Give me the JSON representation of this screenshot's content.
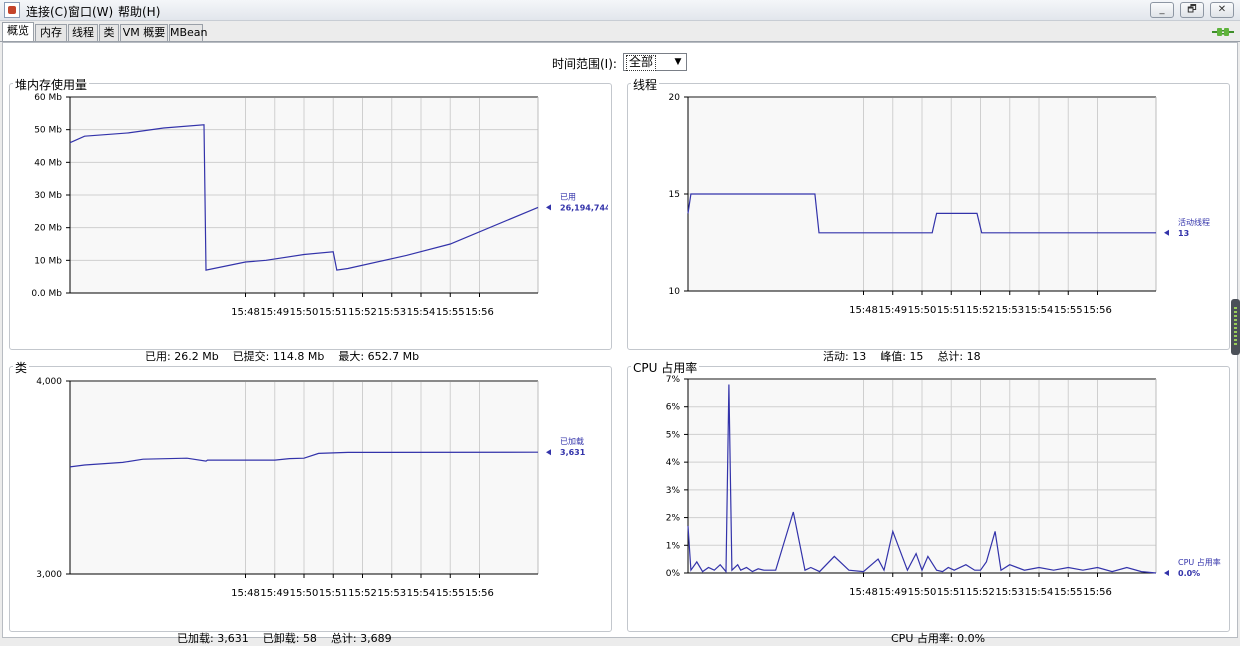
{
  "menubar": {
    "items": [
      "连接(C)",
      "窗口(W)",
      "帮助(H)"
    ],
    "window_buttons": [
      "_",
      "🗗",
      "✕"
    ]
  },
  "tabs": [
    "概览",
    "内存",
    "线程",
    "类",
    "VM 概要",
    "MBean"
  ],
  "time_range": {
    "label": "时间范围(I):",
    "value": "全部"
  },
  "x_ticks": [
    "15:48",
    "15:49",
    "15:50",
    "15:51",
    "15:52",
    "15:53",
    "15:54",
    "15:55",
    "15:56"
  ],
  "panels": {
    "heap": {
      "title": "堆内存使用量",
      "stats": [
        {
          "label": "已用:",
          "value": "26.2 Mb"
        },
        {
          "label": "已提交:",
          "value": "114.8 Mb"
        },
        {
          "label": "最大:",
          "value": "652.7 Mb"
        }
      ]
    },
    "threads": {
      "title": "线程",
      "stats": [
        {
          "label": "活动:",
          "value": "13"
        },
        {
          "label": "峰值:",
          "value": "15"
        },
        {
          "label": "总计:",
          "value": "18"
        }
      ]
    },
    "classes": {
      "title": "类",
      "stats": [
        {
          "label": "已加载:",
          "value": "3,631"
        },
        {
          "label": "已卸载:",
          "value": "58"
        },
        {
          "label": "总计:",
          "value": "3,689"
        }
      ]
    },
    "cpu": {
      "title": "CPU 占用率",
      "stats": [
        {
          "label": "CPU 占用率:",
          "value": "0.0%"
        }
      ]
    }
  },
  "chart_data": [
    {
      "type": "line",
      "title": "堆内存使用量",
      "y_tick_labels": [
        "0.0 Mb",
        "10 Mb",
        "20 Mb",
        "30 Mb",
        "40 Mb",
        "50 Mb",
        "60 Mb"
      ],
      "ylim": [
        0,
        60
      ],
      "xlim": [
        15.42,
        15.58
      ],
      "x_tick_values": [
        15.48,
        15.49,
        15.5,
        15.51,
        15.52,
        15.53,
        15.54,
        15.55,
        15.56
      ],
      "series": [
        {
          "name": "已用",
          "value_label": "26,194,744",
          "x": [
            15.42,
            15.425,
            15.44,
            15.452,
            15.4658,
            15.4665,
            15.48,
            15.487,
            15.5,
            15.51,
            15.5112,
            15.515,
            15.535,
            15.55,
            15.58
          ],
          "y": [
            46,
            48,
            49,
            50.5,
            51.5,
            7,
            9.5,
            10,
            11.8,
            12.6,
            7,
            7.5,
            11.5,
            15,
            26.2
          ]
        }
      ],
      "color": "#3333aa",
      "grid": true
    },
    {
      "type": "line",
      "title": "线程",
      "y_tick_labels": [
        "10",
        "15",
        "20"
      ],
      "ylim": [
        10,
        20
      ],
      "xlim": [
        15.42,
        15.58
      ],
      "x_tick_values": [
        15.48,
        15.49,
        15.5,
        15.51,
        15.52,
        15.53,
        15.54,
        15.55,
        15.56
      ],
      "series": [
        {
          "name": "活动线程",
          "value_label": "13",
          "x": [
            15.42,
            15.421,
            15.4634,
            15.4648,
            15.5035,
            15.505,
            15.5188,
            15.5204,
            15.58
          ],
          "y": [
            14,
            15,
            15,
            13,
            13,
            14,
            14,
            13,
            13
          ]
        }
      ],
      "color": "#3333aa",
      "grid": true
    },
    {
      "type": "line",
      "title": "类",
      "y_tick_labels": [
        "3,000",
        "4,000"
      ],
      "ylim": [
        3000,
        4000
      ],
      "xlim": [
        15.42,
        15.58
      ],
      "x_tick_values": [
        15.48,
        15.49,
        15.5,
        15.51,
        15.52,
        15.53,
        15.54,
        15.55,
        15.56
      ],
      "series": [
        {
          "name": "已加载",
          "value_label": "3,631",
          "x": [
            15.42,
            15.425,
            15.438,
            15.445,
            15.46,
            15.4665,
            15.467,
            15.49,
            15.495,
            15.5,
            15.505,
            15.515,
            15.58
          ],
          "y": [
            3555,
            3565,
            3578,
            3595,
            3600,
            3585,
            3590,
            3590,
            3598,
            3600,
            3625,
            3630,
            3631
          ]
        }
      ],
      "color": "#3333aa",
      "grid": true
    },
    {
      "type": "line",
      "title": "CPU 占用率",
      "y_tick_labels": [
        "0%",
        "1%",
        "2%",
        "3%",
        "4%",
        "5%",
        "6%",
        "7%"
      ],
      "ylim": [
        0,
        7
      ],
      "xlim": [
        15.42,
        15.58
      ],
      "x_tick_values": [
        15.48,
        15.49,
        15.5,
        15.51,
        15.52,
        15.53,
        15.54,
        15.55,
        15.56
      ],
      "series": [
        {
          "name": "CPU 占用率",
          "value_label": "0.0%",
          "x": [
            15.42,
            15.421,
            15.423,
            15.425,
            15.427,
            15.429,
            15.431,
            15.433,
            15.434,
            15.435,
            15.437,
            15.438,
            15.44,
            15.442,
            15.444,
            15.446,
            15.45,
            15.456,
            15.46,
            15.462,
            15.465,
            15.47,
            15.475,
            15.48,
            15.485,
            15.487,
            15.49,
            15.495,
            15.498,
            15.5,
            15.502,
            15.505,
            15.507,
            15.509,
            15.511,
            15.515,
            15.518,
            15.52,
            15.522,
            15.525,
            15.527,
            15.53,
            15.535,
            15.54,
            15.545,
            15.55,
            15.555,
            15.56,
            15.565,
            15.57,
            15.575,
            15.58
          ],
          "y": [
            1.7,
            0.1,
            0.4,
            0.05,
            0.2,
            0.1,
            0.3,
            0.05,
            6.8,
            0.1,
            0.3,
            0.1,
            0.2,
            0.05,
            0.15,
            0.1,
            0.1,
            2.2,
            0.1,
            0.2,
            0.05,
            0.6,
            0.1,
            0.05,
            0.5,
            0.1,
            1.5,
            0.1,
            0.7,
            0.1,
            0.6,
            0.1,
            0.05,
            0.2,
            0.1,
            0.3,
            0.1,
            0.1,
            0.4,
            1.5,
            0.1,
            0.3,
            0.1,
            0.2,
            0.1,
            0.2,
            0.1,
            0.2,
            0.05,
            0.2,
            0.05,
            0.0
          ]
        }
      ],
      "color": "#3333aa",
      "grid": true
    }
  ]
}
